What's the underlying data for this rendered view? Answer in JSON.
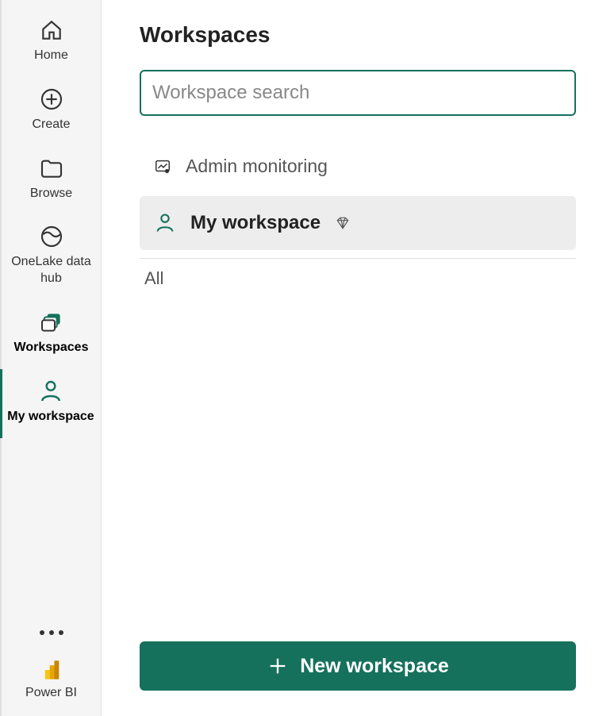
{
  "sidebar": {
    "home": "Home",
    "create": "Create",
    "browse": "Browse",
    "onelake": "OneLake data hub",
    "workspaces": "Workspaces",
    "myworkspace": "My workspace",
    "powerbi": "Power BI"
  },
  "panel": {
    "title": "Workspaces",
    "search_placeholder": "Workspace search",
    "items": {
      "admin": "Admin monitoring",
      "my": "My workspace"
    },
    "section_all": "All",
    "new_button": "New workspace"
  },
  "colors": {
    "accent": "#15715c"
  }
}
